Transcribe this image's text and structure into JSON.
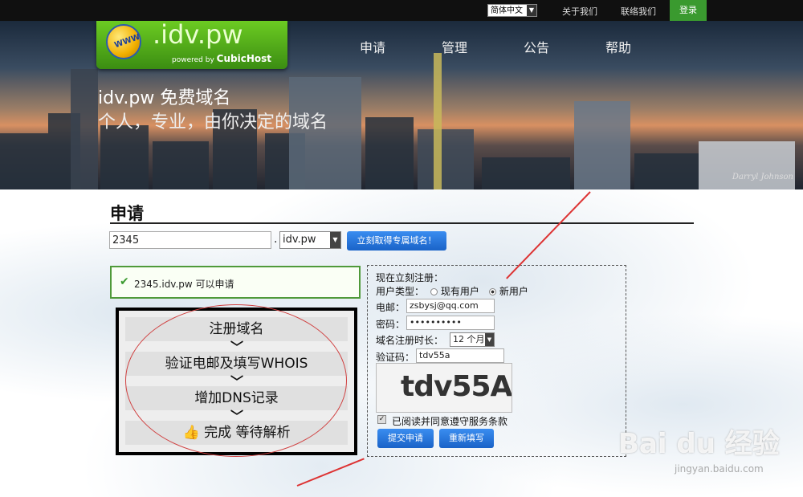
{
  "topbar": {
    "language": "简体中文",
    "links": [
      "关于我们",
      "联络我们"
    ],
    "login": "登录"
  },
  "logo": {
    "badge": "WWW",
    "domain": ".idv.pw",
    "powered_prefix": "powered by",
    "powered_brand": "CubicHost"
  },
  "nav": [
    "申请",
    "管理",
    "公告",
    "帮助"
  ],
  "hero": {
    "title": "idv.pw 免费域名",
    "subtitle": "个人，专业，由你决定的域名",
    "photo_credit": "Darryl Johnson"
  },
  "apply": {
    "title": "申请",
    "domain_value": "2345",
    "dot": ".",
    "tld": "idv.pw",
    "get_button": "立刻取得专属域名！",
    "available_text": "2345.idv.pw 可以申请"
  },
  "steps": [
    "注册域名",
    "验证电邮及填写WHOIS",
    "增加DNS记录",
    "完成 等待解析"
  ],
  "register": {
    "heading": "现在立刻注册：",
    "user_type_label": "用户类型：",
    "existing_user": "现有用户",
    "new_user": "新用户",
    "email_label": "电邮：",
    "email_value": "zsbysj@qq.com",
    "password_label": "密码：",
    "password_value": "••••••••••",
    "period_label": "域名注册时长：",
    "period_value": "12 个月",
    "captcha_label": "验证码：",
    "captcha_value": "tdv55a",
    "captcha_image_text": "tdv55A",
    "agree_text": "已阅读并同意遵守服务条款",
    "submit": "提交申请",
    "reset": "重新填写"
  },
  "watermark": {
    "brand": "Bai du 经验",
    "url": "jingyan.baidu.com"
  }
}
